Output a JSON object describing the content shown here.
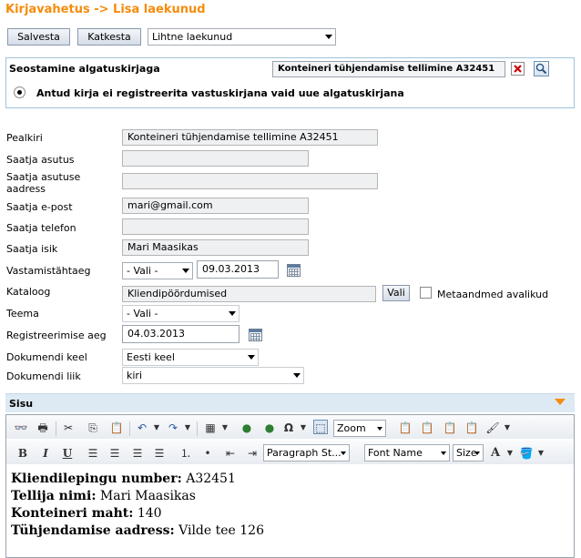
{
  "page": {
    "title": "Kirjavahetus -> Lisa laekunud"
  },
  "toolbar": {
    "save_label": "Salvesta",
    "cancel_label": "Katkesta",
    "type_select_value": "Lihtne laekunud"
  },
  "link": {
    "heading": "Seostamine algatuskirjaga",
    "linked_doc": "Konteineri tühjendamise tellimine A32451",
    "radio_label": "Antud kirja ei registreerita vastuskirjana vaid uue algatuskirjana"
  },
  "form": {
    "pealkiri_label": "Pealkiri",
    "pealkiri_value": "Konteineri tühjendamise tellimine A32451",
    "saatja_asutus_label": "Saatja asutus",
    "saatja_asutus_value": "",
    "saatja_aadress_label": "Saatja asutuse aadress",
    "saatja_aadress_value": "",
    "epost_label": "Saatja e-post",
    "epost_value": "mari@gmail.com",
    "telefon_label": "Saatja telefon",
    "telefon_value": "",
    "isik_label": "Saatja isik",
    "isik_value": "Mari Maasikas",
    "tahtaeg_label": "Vastamistähtaeg",
    "tahtaeg_select": "- Vali -",
    "tahtaeg_date": "09.03.2013",
    "kataloog_label": "Kataloog",
    "kataloog_value": "Kliendipöördumised",
    "kataloog_button": "Vali",
    "metaandmed_label": "Metaandmed avalikud",
    "teema_label": "Teema",
    "teema_value": "- Vali -",
    "reg_aeg_label": "Registreerimise aeg",
    "reg_aeg_value": "04.03.2013",
    "keel_label": "Dokumendi keel",
    "keel_value": "Eesti keel",
    "liik_label": "Dokumendi liik",
    "liik_value": "kiri"
  },
  "sisu": {
    "heading": "Sisu",
    "zoom": "Zoom",
    "paragraph_style": "Paragraph St...",
    "font_name": "Font Name",
    "size": "Size",
    "lines": [
      {
        "label": "Kliendilepingu number:",
        "value": " A32451"
      },
      {
        "label": "Tellija nimi:",
        "value": " Mari Maasikas"
      },
      {
        "label": "Konteineri maht:",
        "value": " 140"
      },
      {
        "label": "Tühjendamise aadress:",
        "value": " Vilde tee 126"
      }
    ]
  },
  "colors": {
    "title": "#f58c0c",
    "accent_border": "#9fc3dc",
    "section_bar": "#dde9f3",
    "delete_icon": "#cc0000"
  }
}
